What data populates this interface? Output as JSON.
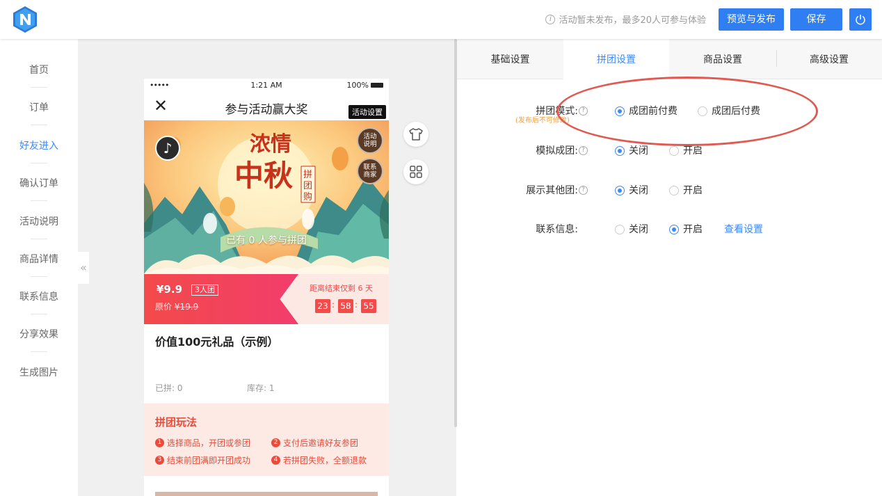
{
  "topbar": {
    "notice": "活动暂未发布，最多20人可参与体验",
    "publish_label": "预览与发布",
    "save_label": "保存"
  },
  "sidebar": {
    "items": [
      {
        "label": "首页"
      },
      {
        "label": "订单"
      },
      {
        "label": "好友进入"
      },
      {
        "label": "确认订单"
      },
      {
        "label": "活动说明"
      },
      {
        "label": "商品详情"
      },
      {
        "label": "联系信息"
      },
      {
        "label": "分享效果"
      },
      {
        "label": "生成图片"
      }
    ],
    "active_index": 2
  },
  "phone": {
    "status": {
      "signal": "•••••",
      "time": "1:21 AM",
      "battery": "100%"
    },
    "title": "参与活动赢大奖",
    "settings_tag": "活动设置",
    "banner": {
      "rules_badge": "活动说明",
      "contact_badge": "联系商家",
      "joined_text": "已有 0 人参与拼团",
      "headline": "浓情中秋",
      "sub_headline": "拼团购"
    },
    "price": {
      "value": "¥9.9",
      "group_size": "3人团",
      "original_label": "原价",
      "original_value": "¥19.9",
      "countdown_label": "距离结束仅剩 6 天",
      "hours": "23",
      "minutes": "58",
      "seconds": "55",
      "separator": ":"
    },
    "product_name": "价值100元礼品（示例）",
    "joined_stat": "已拼: 0",
    "stock_stat": "库存: 1",
    "rules_title": "拼团玩法",
    "rules": [
      {
        "num": "1",
        "text": "选择商品，开团或参团"
      },
      {
        "num": "2",
        "text": "支付后邀请好友参团"
      },
      {
        "num": "3",
        "text": "结束前团满即开团成功"
      },
      {
        "num": "4",
        "text": "若拼团失败，全额退款"
      }
    ]
  },
  "panel": {
    "tabs": [
      {
        "label": "基础设置"
      },
      {
        "label": "拼团设置"
      },
      {
        "label": "商品设置"
      },
      {
        "label": "高级设置"
      }
    ],
    "active_tab": 1,
    "mode": {
      "label": "拼团模式:",
      "note": "(发布后不可修改)",
      "options": [
        "成团前付费",
        "成团后付费"
      ],
      "selected": 0
    },
    "simulate": {
      "label": "模拟成团:",
      "options": [
        "关闭",
        "开启"
      ],
      "selected": 0
    },
    "show_other": {
      "label": "展示其他团:",
      "options": [
        "关闭",
        "开启"
      ],
      "selected": 0
    },
    "contact": {
      "label": "联系信息:",
      "options": [
        "关闭",
        "开启"
      ],
      "selected": 1,
      "link": "查看设置"
    }
  },
  "colors": {
    "accent": "#3d8af7",
    "price_red": "#f34a4a",
    "annotation": "#e05a52"
  }
}
